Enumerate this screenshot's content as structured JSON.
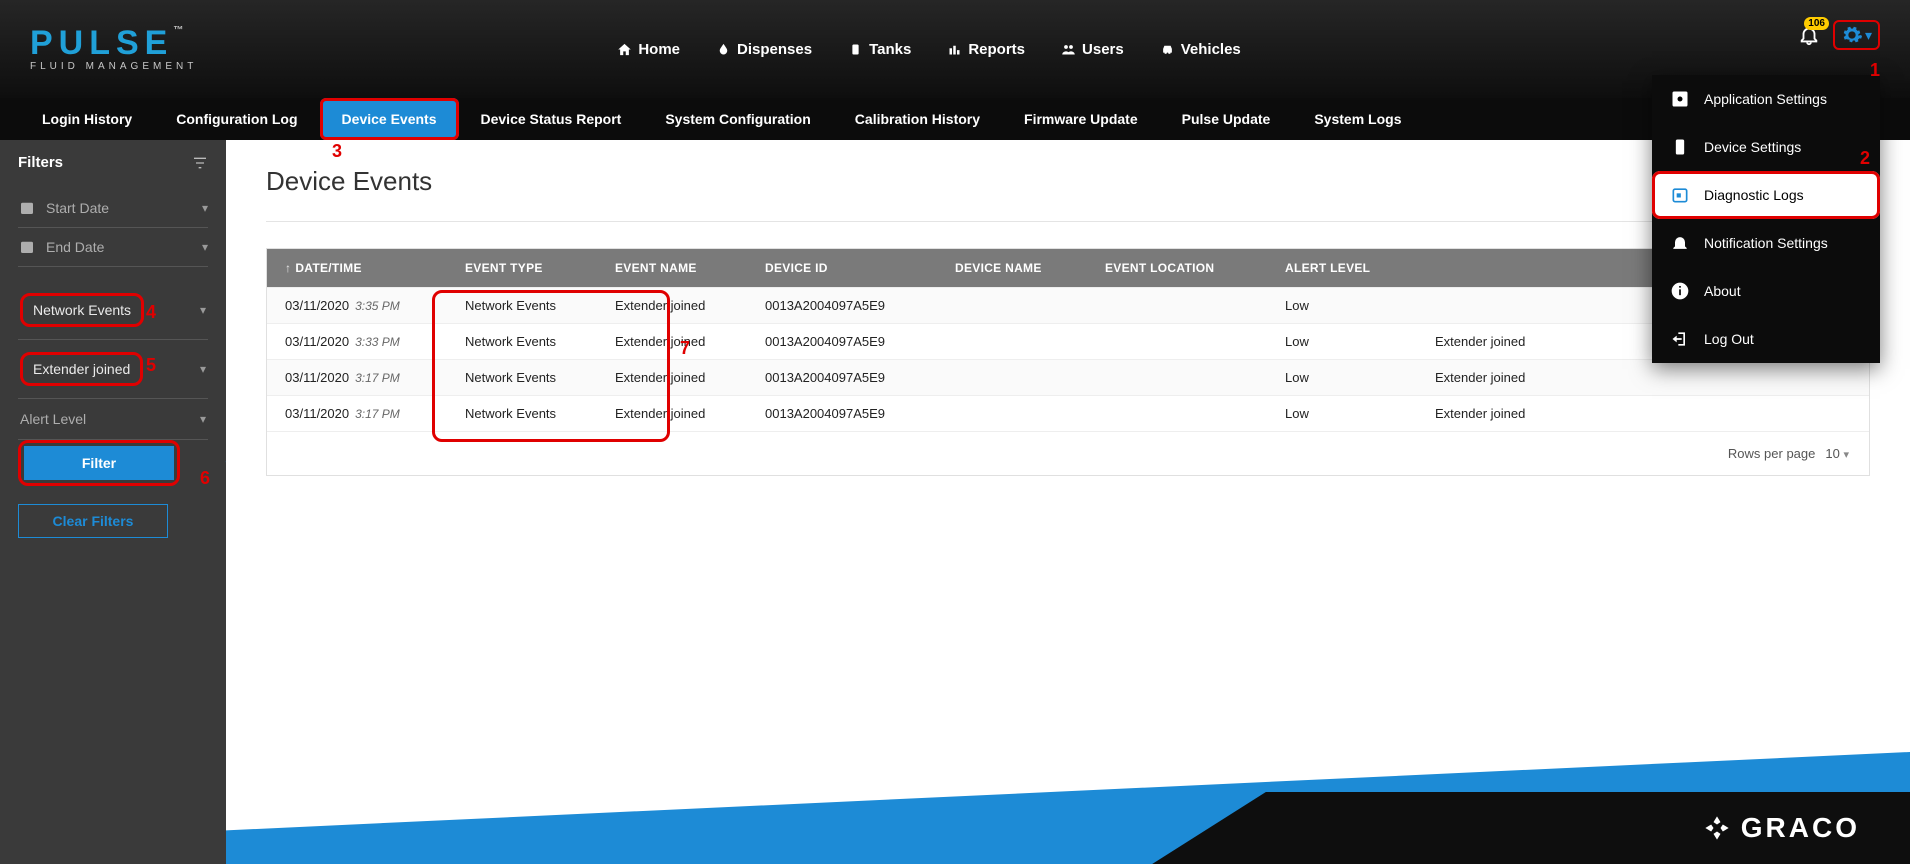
{
  "logo": {
    "title": "PULSE",
    "tm": "™",
    "sub": "FLUID MANAGEMENT"
  },
  "topnav": {
    "home": "Home",
    "dispenses": "Dispenses",
    "tanks": "Tanks",
    "reports": "Reports",
    "users": "Users",
    "vehicles": "Vehicles"
  },
  "notif_badge": "106",
  "menu": {
    "items": [
      {
        "label": "Application Settings"
      },
      {
        "label": "Device Settings"
      },
      {
        "label": "Diagnostic Logs"
      },
      {
        "label": "Notification Settings"
      },
      {
        "label": "About"
      },
      {
        "label": "Log Out"
      }
    ]
  },
  "subnav": {
    "items": [
      "Login History",
      "Configuration Log",
      "Device Events",
      "Device Status Report",
      "System Configuration",
      "Calibration History",
      "Firmware Update",
      "Pulse Update",
      "System Logs"
    ],
    "active_index": 2
  },
  "sidebar": {
    "title": "Filters",
    "start_date": "Start Date",
    "end_date": "End Date",
    "filter1": "Network Events",
    "filter2": "Extender joined",
    "filter3": "Alert Level",
    "filter_btn": "Filter",
    "clear_btn": "Clear Filters"
  },
  "page": {
    "title": "Device Events"
  },
  "table": {
    "headers": {
      "datetime": "DATE/TIME",
      "event_type": "EVENT TYPE",
      "event_name": "EVENT NAME",
      "device_id": "DEVICE ID",
      "device_name": "DEVICE NAME",
      "event_location": "EVENT LOCATION",
      "alert_level": "ALERT LEVEL",
      "extra": ""
    },
    "rows": [
      {
        "date": "03/11/2020",
        "time": "3:35 PM",
        "event_type": "Network Events",
        "event_name": "Extender joined",
        "device_id": "0013A2004097A5E9",
        "device_name": "",
        "event_location": "",
        "alert_level": "Low",
        "extra": ""
      },
      {
        "date": "03/11/2020",
        "time": "3:33 PM",
        "event_type": "Network Events",
        "event_name": "Extender joined",
        "device_id": "0013A2004097A5E9",
        "device_name": "",
        "event_location": "",
        "alert_level": "Low",
        "extra": "Extender joined"
      },
      {
        "date": "03/11/2020",
        "time": "3:17 PM",
        "event_type": "Network Events",
        "event_name": "Extender joined",
        "device_id": "0013A2004097A5E9",
        "device_name": "",
        "event_location": "",
        "alert_level": "Low",
        "extra": "Extender joined"
      },
      {
        "date": "03/11/2020",
        "time": "3:17 PM",
        "event_type": "Network Events",
        "event_name": "Extender joined",
        "device_id": "0013A2004097A5E9",
        "device_name": "",
        "event_location": "",
        "alert_level": "Low",
        "extra": "Extender joined"
      }
    ],
    "footer": {
      "label": "Rows per page",
      "value": "10"
    }
  },
  "footer_brand": "GRACO",
  "annotations": {
    "n1": "1",
    "n2": "2",
    "n3": "3",
    "n4": "4",
    "n5": "5",
    "n6": "6",
    "n7": "7"
  }
}
